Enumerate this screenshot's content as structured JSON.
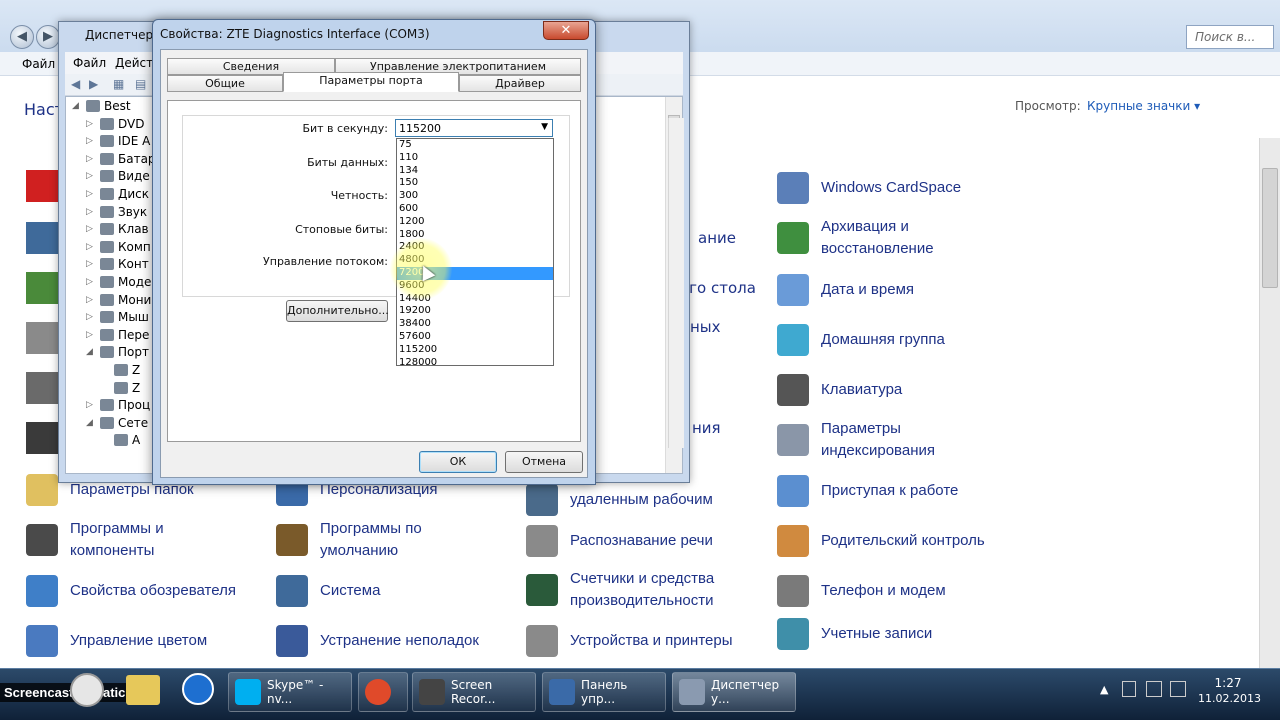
{
  "control_panel": {
    "search_placeholder": "Поиск в...",
    "menu_file": "Файл",
    "heading": "Наст",
    "view_label": "Просмотр:",
    "view_value": "Крупные значки ▾",
    "items": [
      {
        "label": "Windows CardSpace",
        "color": "#5b7fb8"
      },
      {
        "label": "Архивация и восстановление",
        "color": "#3f8f3f"
      },
      {
        "label": "Дата и время",
        "color": "#6a9bd8"
      },
      {
        "label": "Домашняя группа",
        "color": "#3fa9d0"
      },
      {
        "label": "Клавиатура",
        "color": "#555555"
      },
      {
        "label": "Параметры индексирования",
        "color": "#8a96a8"
      },
      {
        "label": "Приступая к работе",
        "color": "#5b8fd0"
      },
      {
        "label": "Родительский контроль",
        "color": "#d08a3f"
      },
      {
        "label": "Телефон и модем",
        "color": "#7a7a7a"
      },
      {
        "label": "Учетные записи",
        "color": "#3f8fa9"
      },
      {
        "label": "ание",
        "color": "#ffffff"
      },
      {
        "label": "ого стола",
        "color": "#ffffff"
      },
      {
        "label": "ных",
        "color": "#ffffff"
      },
      {
        "label": "ния",
        "color": "#ffffff"
      },
      {
        "label": "Параметры папок",
        "color": "#e0c060"
      },
      {
        "label": "Персонализация",
        "color": "#3a6aa8"
      },
      {
        "label": "удаленным рабочим",
        "color": "#4a6a8a"
      },
      {
        "label": "Программы и компоненты",
        "color": "#4a4a4a"
      },
      {
        "label": "Программы по умолчанию",
        "color": "#7a5a2a"
      },
      {
        "label": "Распознавание речи",
        "color": "#8a8a8a"
      },
      {
        "label": "Свойства обозревателя",
        "color": "#3f7fc8"
      },
      {
        "label": "Система",
        "color": "#3f6a9a"
      },
      {
        "label": "Счетчики и средства производительности",
        "color": "#2a5a3a"
      },
      {
        "label": "Управление цветом",
        "color": "#4a7ac0"
      },
      {
        "label": "Устранение неполадок",
        "color": "#3a5a9a"
      },
      {
        "label": "Устройства и принтеры",
        "color": "#8a8a8a"
      },
      {
        "label": "",
        "color": "#d02020"
      },
      {
        "label": "",
        "color": "#3f6a9a"
      },
      {
        "label": "",
        "color": "#4a8a3a"
      },
      {
        "label": "",
        "color": "#8a8a8a"
      },
      {
        "label": "",
        "color": "#6a6a6a"
      },
      {
        "label": "",
        "color": "#3a3a3a"
      }
    ]
  },
  "device_manager": {
    "title": "Диспетчер у",
    "menu": [
      "Файл",
      "Действ"
    ],
    "tree": [
      {
        "label": "Best",
        "exp": "◢"
      },
      {
        "label": "DVD",
        "exp": "▷"
      },
      {
        "label": "IDE A",
        "exp": "▷"
      },
      {
        "label": "Батар",
        "exp": "▷"
      },
      {
        "label": "Виде",
        "exp": "▷"
      },
      {
        "label": "Диск",
        "exp": "▷"
      },
      {
        "label": "Звук",
        "exp": "▷"
      },
      {
        "label": "Клав",
        "exp": "▷"
      },
      {
        "label": "Комп",
        "exp": "▷"
      },
      {
        "label": "Конт",
        "exp": "▷"
      },
      {
        "label": "Моде",
        "exp": "▷"
      },
      {
        "label": "Мони",
        "exp": "▷"
      },
      {
        "label": "Мыш",
        "exp": "▷"
      },
      {
        "label": "Пере",
        "exp": "▷"
      },
      {
        "label": "Порт",
        "exp": "◢"
      },
      {
        "label": "Z",
        "exp": ""
      },
      {
        "label": "Z",
        "exp": ""
      },
      {
        "label": "Проц",
        "exp": "▷"
      },
      {
        "label": "Сете",
        "exp": "◢"
      },
      {
        "label": "A",
        "exp": ""
      }
    ]
  },
  "dialog": {
    "title": "Свойства: ZTE Diagnostics Interface (COM3)",
    "close_glyph": "✕",
    "tabs": {
      "details": "Сведения",
      "power": "Управление электропитанием",
      "general": "Общие",
      "port": "Параметры порта",
      "driver": "Драйвер"
    },
    "fields": {
      "baud": "Бит в секунду:",
      "data_bits": "Биты данных:",
      "parity": "Четность:",
      "stop_bits": "Стоповые биты:",
      "flow": "Управление потоком:"
    },
    "baud_selected": "115200",
    "dropdown_arrow": "▼",
    "baud_options": [
      "75",
      "110",
      "134",
      "150",
      "300",
      "600",
      "1200",
      "1800",
      "2400",
      "4800",
      "7200",
      "9600",
      "14400",
      "19200",
      "38400",
      "57600",
      "115200",
      "128000"
    ],
    "baud_highlighted": "7200",
    "advanced_button": "Дополнительно...",
    "ok_button": "ОК",
    "cancel_button": "Отмена"
  },
  "taskbar": {
    "watermark": "Screencast-O-Matic.com",
    "buttons": [
      {
        "label": "Skype™ - nv...",
        "color": "#00aff0"
      },
      {
        "label": "",
        "color": "#e04a2a"
      },
      {
        "label": "Screen Recor...",
        "color": "#444444"
      },
      {
        "label": "Панель упр...",
        "color": "#3a6aa8"
      },
      {
        "label": "Диспетчер у...",
        "color": "#8a9ab0"
      }
    ],
    "time": "1:27",
    "date": "11.02.2013"
  }
}
